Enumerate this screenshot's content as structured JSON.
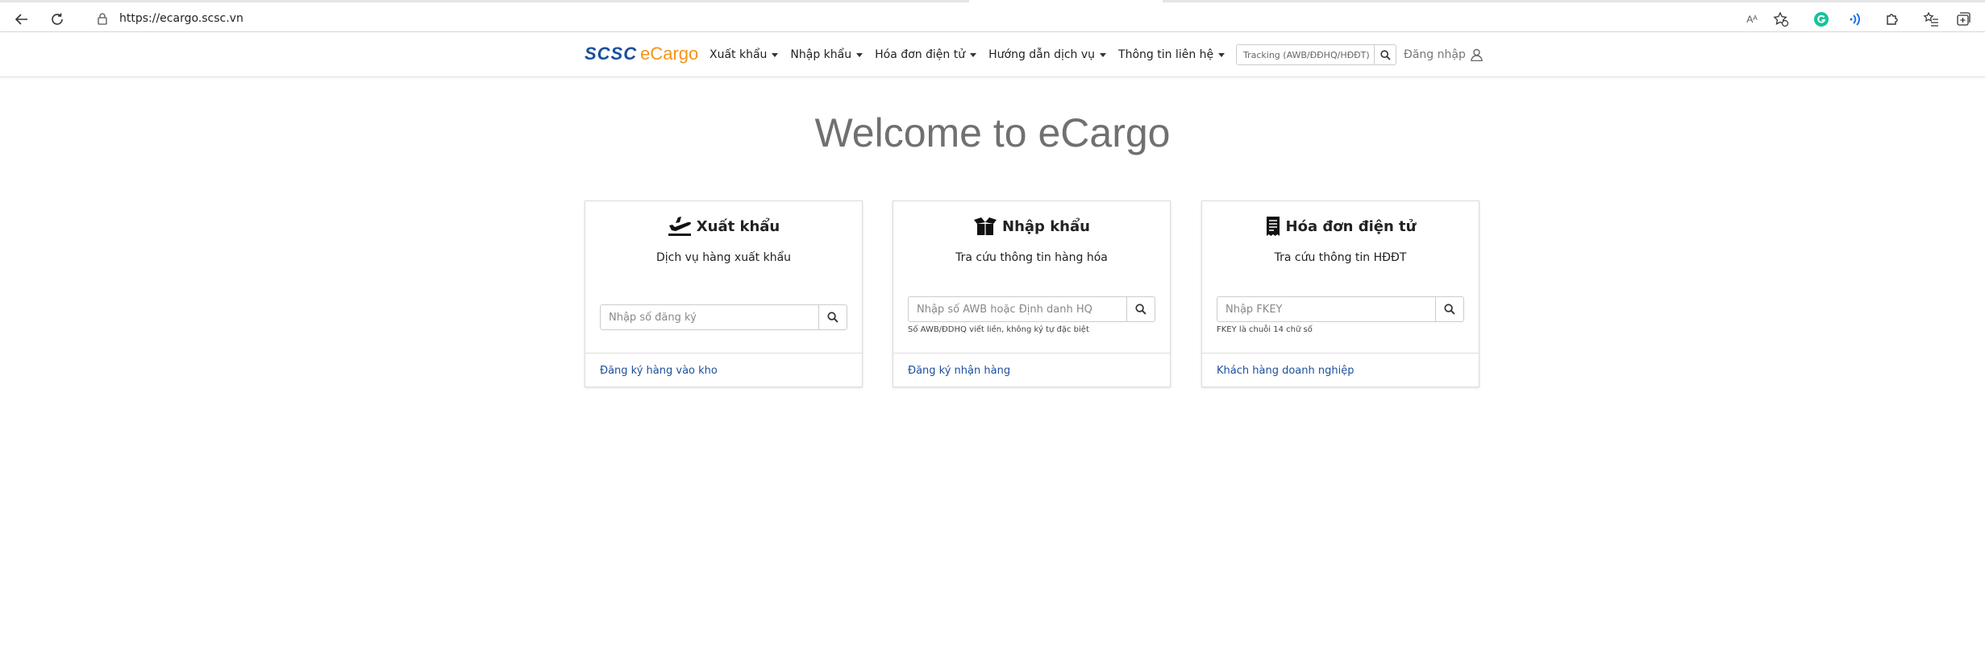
{
  "browser": {
    "url": "https://ecargo.scsc.vn",
    "read_aloud_icon_text": "Aᴬ"
  },
  "header": {
    "brand_scsc": "SCSC",
    "brand_ecargo": "eCargo",
    "menu": [
      {
        "label": "Xuất khẩu"
      },
      {
        "label": "Nhập khẩu"
      },
      {
        "label": "Hóa đơn điện tử"
      },
      {
        "label": "Hướng dẫn dịch vụ"
      },
      {
        "label": "Thông tin liên hệ"
      }
    ],
    "tracking_placeholder": "Tracking (AWB/ĐĐHQ/HĐĐT)",
    "login_label": "Đăng nhập"
  },
  "main": {
    "welcome": "Welcome to eCargo",
    "cards": [
      {
        "title": "Xuất khẩu",
        "subtitle": "Dịch vụ hàng xuất khẩu",
        "input_placeholder": "Nhập số đăng ký",
        "hint": "",
        "footer_link": "Đăng ký hàng vào kho",
        "icon": "plane-departure-icon"
      },
      {
        "title": "Nhập khẩu",
        "subtitle": "Tra cứu thông tin hàng hóa",
        "input_placeholder": "Nhập số AWB hoặc Định danh HQ",
        "hint": "Số AWB/ĐDHQ viết liền, không ký tự đặc biệt",
        "footer_link": "Đăng ký nhận hàng",
        "icon": "box-open-icon"
      },
      {
        "title": "Hóa đơn điện tử",
        "subtitle": "Tra cứu thông tin HĐĐT",
        "input_placeholder": "Nhập FKEY",
        "hint": "FKEY là chuỗi 14 chữ số",
        "footer_link": "Khách hàng doanh nghiệp",
        "icon": "receipt-icon"
      }
    ]
  },
  "colors": {
    "brand_blue": "#1a4f9c",
    "brand_orange": "#f39419",
    "link_blue": "#1c4f9d",
    "welcome_gray": "#707070"
  }
}
